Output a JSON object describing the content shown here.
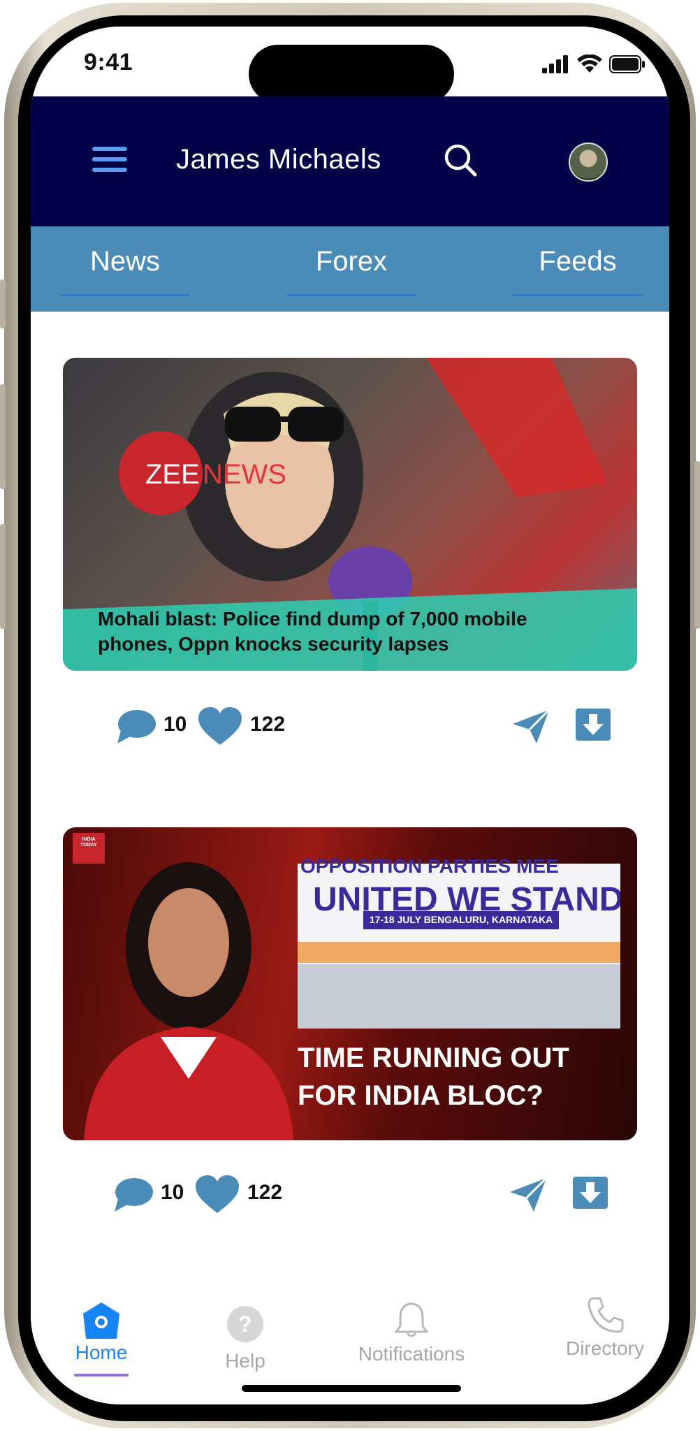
{
  "status_bar": {
    "time": "9:41"
  },
  "header": {
    "title": "James Michaels"
  },
  "tabs": [
    {
      "label": "News"
    },
    {
      "label": "Forex"
    },
    {
      "label": "Feeds"
    }
  ],
  "posts": [
    {
      "source_logo_text": "ZEENEWS",
      "headline": "Mohali blast: Police find dump of 7,000 mobile phones, Oppn knocks security lapses",
      "comments": "10",
      "likes": "122"
    },
    {
      "source_logo_text": "INDIA TODAY",
      "banner_line1": "OPPOSITION PARTIES MEE",
      "banner_line2": "UNITED WE STAND",
      "banner_line3": "17-18 JULY BENGALURU, KARNATAKA",
      "headline_line1": "TIME RUNNING OUT",
      "headline_line2": "FOR INDIA BLOC?",
      "comments": "10",
      "likes": "122"
    }
  ],
  "bottom_nav": [
    {
      "label": "Home",
      "icon": "home-icon",
      "active": true
    },
    {
      "label": "Help",
      "icon": "help-icon",
      "active": false
    },
    {
      "label": "Notifications",
      "icon": "bell-icon",
      "active": false
    },
    {
      "label": "Directory",
      "icon": "phone-icon",
      "active": false
    }
  ],
  "colors": {
    "header_bg": "#020248",
    "tab_bar_bg": "#4a8bb8",
    "accent_blue": "#4a8bb8",
    "active_nav": "#1684f5"
  }
}
